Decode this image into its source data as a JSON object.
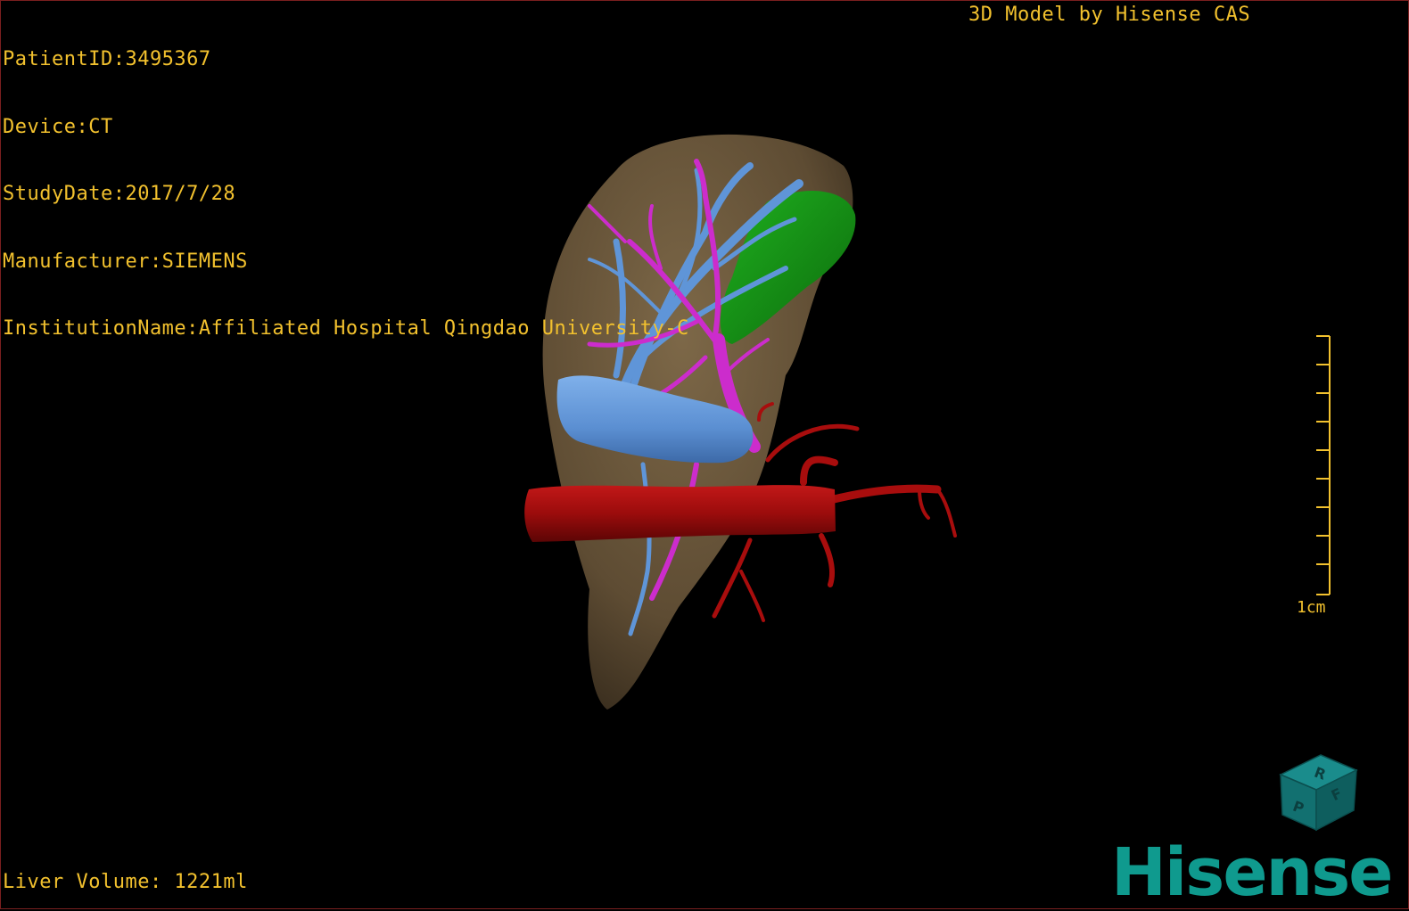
{
  "patient_info": {
    "patient_id": "PatientID:3495367",
    "device": "Device:CT",
    "study_date": "StudyDate:2017/7/28",
    "manufacturer": "Manufacturer:SIEMENS",
    "institution": "InstitutionName:Affiliated Hospital Qingdao University-C"
  },
  "model_credit": "3D Model by Hisense CAS",
  "liver_volume": "Liver Volume: 1221ml",
  "scale_bar": {
    "label": "1cm",
    "tick_count": 10
  },
  "orientation_cube": {
    "faces": [
      "R",
      "F",
      "P"
    ]
  },
  "brand": "Hisense",
  "colors": {
    "text": "#f2c12e",
    "liver": "#6e5a3e",
    "portal_vein": "#5f95d8",
    "hepatic_vein": "#cc2ccc",
    "artery_aorta": "#a80d0d",
    "gallbladder": "#1c9a1c",
    "brand": "#0f9a8e"
  },
  "structures": [
    "liver",
    "portal-vein",
    "hepatic-vein",
    "aorta",
    "gallbladder"
  ]
}
